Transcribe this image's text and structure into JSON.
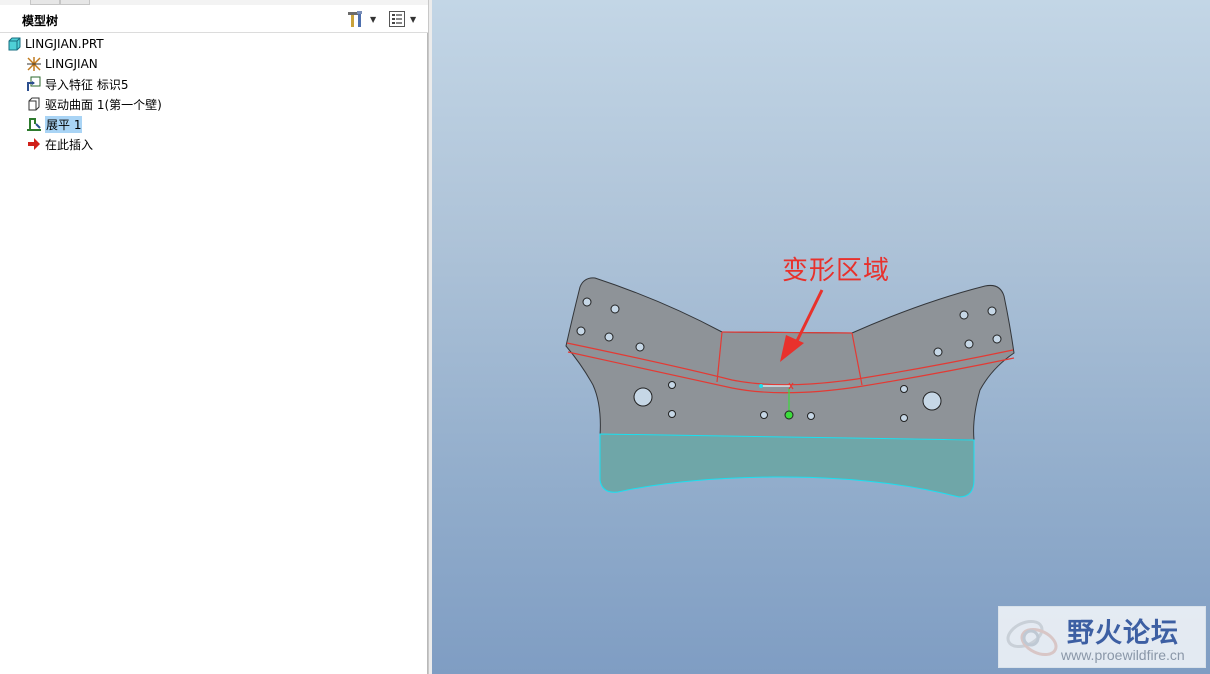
{
  "model_tree": {
    "title": "模型树",
    "items": [
      {
        "label": "LINGJIAN.PRT",
        "icon": "part-icon"
      },
      {
        "label": "LINGJIAN",
        "icon": "coordinate-system-icon"
      },
      {
        "label": "导入特征 标识5",
        "icon": "import-feature-icon"
      },
      {
        "label": "驱动曲面 1(第一个壁)",
        "icon": "driving-surface-icon"
      },
      {
        "label": "展平 1",
        "icon": "flatten-icon",
        "selected": true
      },
      {
        "label": "在此插入",
        "icon": "insert-here-arrow-icon"
      }
    ]
  },
  "viewport": {
    "annotation": "变形区域",
    "annotation_color": "#e8312c",
    "part_color": "#8e9398",
    "flange_color": "#6fa6a8",
    "edge_highlight_color": "#e33a34"
  },
  "watermark": {
    "title": "野火论坛",
    "url": "www.proewildfire.cn"
  }
}
